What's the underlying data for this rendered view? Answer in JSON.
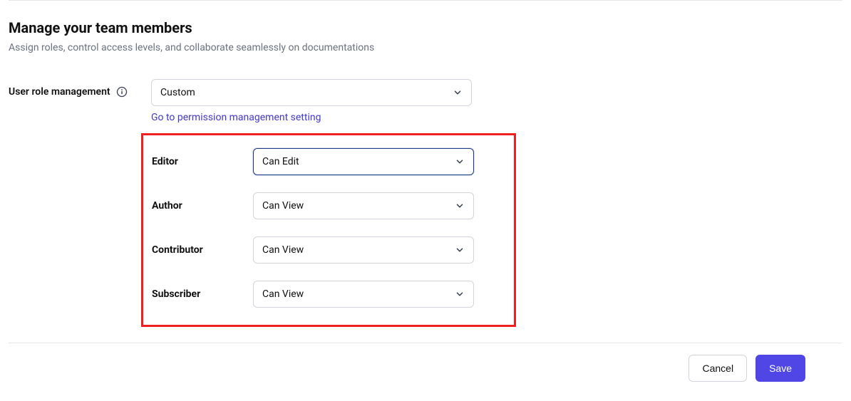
{
  "header": {
    "title": "Manage your team members",
    "subtitle": "Assign roles, control access levels, and collaborate seamlessly on documentations"
  },
  "userRole": {
    "label": "User role management",
    "selected": "Custom",
    "link": "Go to permission management setting"
  },
  "roles": [
    {
      "label": "Editor",
      "value": "Can Edit",
      "active": true
    },
    {
      "label": "Author",
      "value": "Can View",
      "active": false
    },
    {
      "label": "Contributor",
      "value": "Can View",
      "active": false
    },
    {
      "label": "Subscriber",
      "value": "Can View",
      "active": false
    }
  ],
  "footer": {
    "cancel": "Cancel",
    "save": "Save"
  }
}
